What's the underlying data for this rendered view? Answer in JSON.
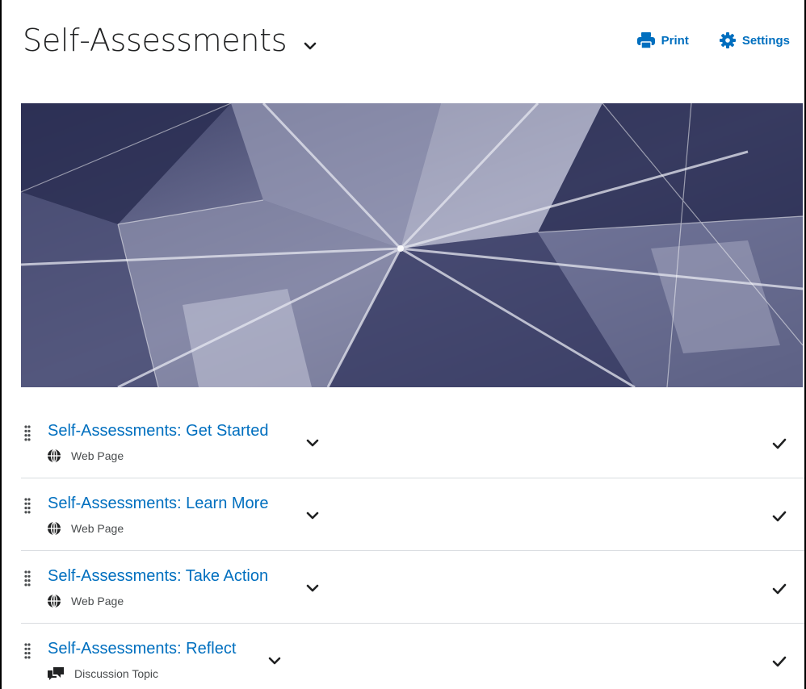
{
  "header": {
    "title": "Self-Assessments",
    "print_label": "Print",
    "settings_label": "Settings"
  },
  "colors": {
    "link": "#006fbf",
    "title": "#202122",
    "subtext": "#494c4e",
    "divider": "#d9dce0"
  },
  "items": [
    {
      "title": "Self-Assessments: Get Started",
      "type": "Web Page",
      "icon": "globe-icon"
    },
    {
      "title": "Self-Assessments: Learn More",
      "type": "Web Page",
      "icon": "globe-icon"
    },
    {
      "title": "Self-Assessments: Take Action",
      "type": "Web Page",
      "icon": "globe-icon"
    },
    {
      "title": "Self-Assessments: Reflect",
      "type": "Discussion Topic",
      "icon": "discussion-icon"
    }
  ]
}
